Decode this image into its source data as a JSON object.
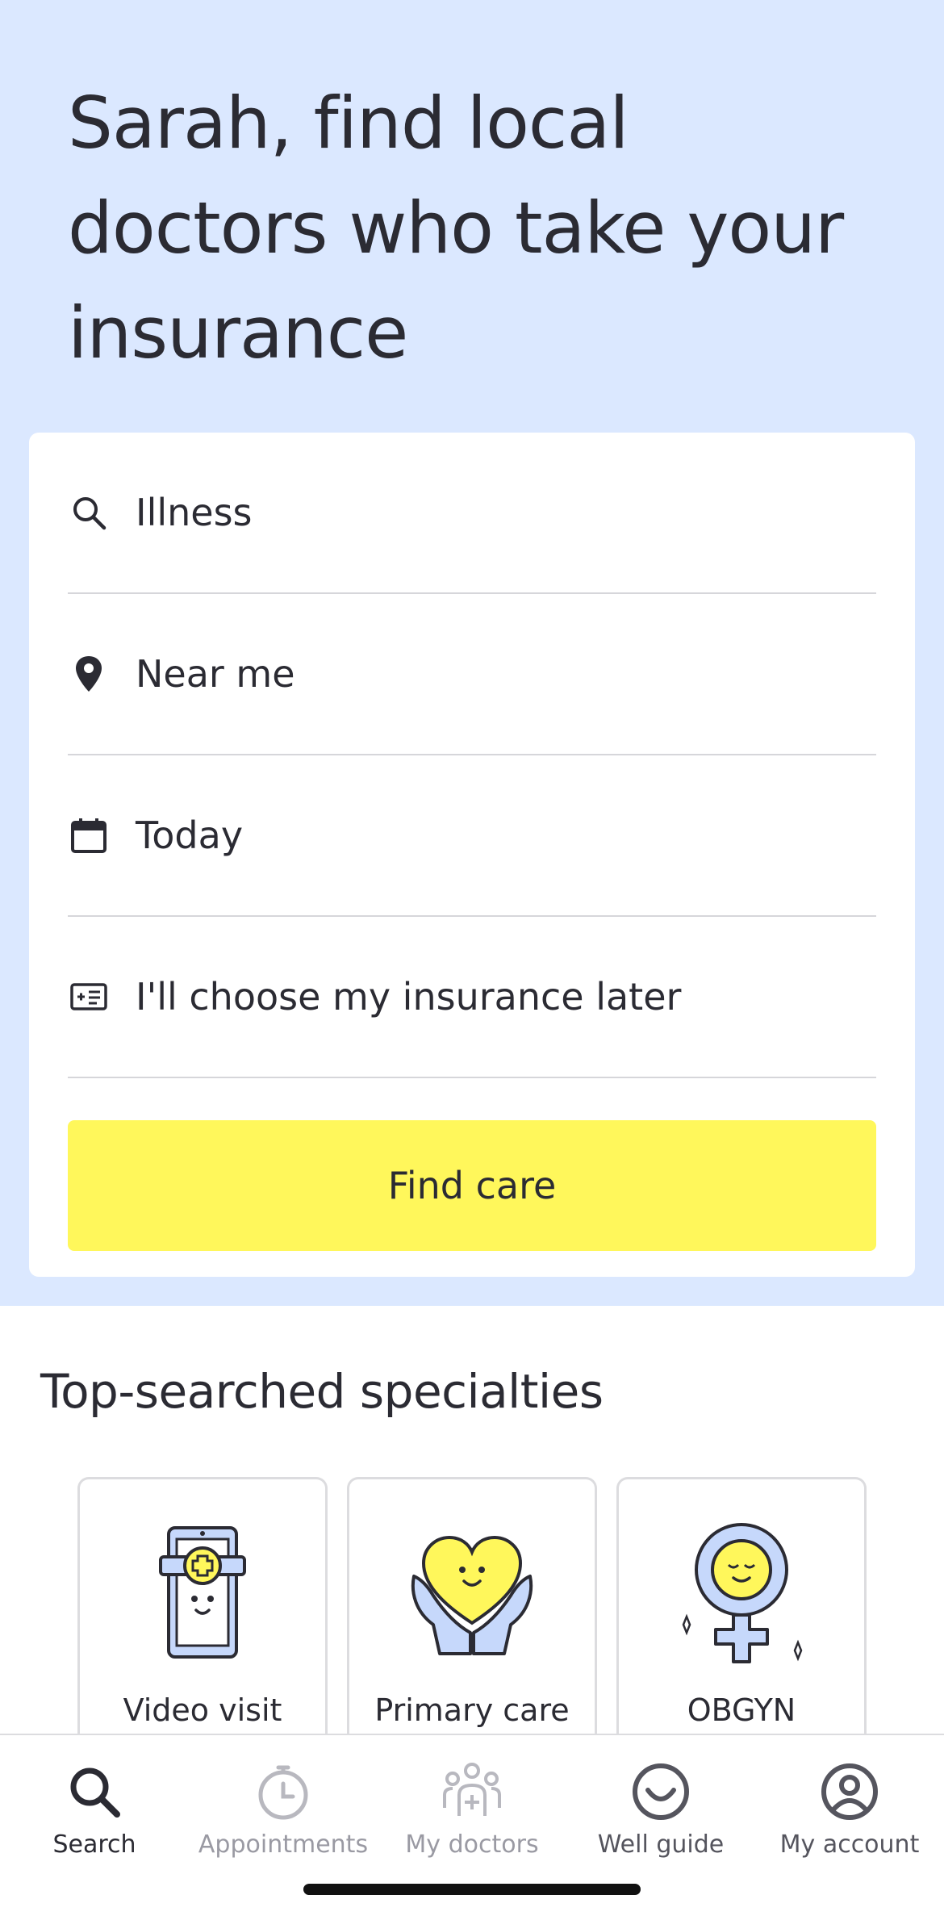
{
  "hero": {
    "title": "Sarah, find local doctors who take your insurance"
  },
  "search_form": {
    "fields": [
      {
        "icon": "search-icon",
        "value": "Illness"
      },
      {
        "icon": "location-pin-icon",
        "value": "Near me"
      },
      {
        "icon": "calendar-icon",
        "value": "Today"
      },
      {
        "icon": "insurance-card-icon",
        "value": "I'll choose my insurance later"
      }
    ],
    "submit_label": "Find care"
  },
  "specialties": {
    "title": "Top-searched specialties",
    "items": [
      {
        "label": "Video visit",
        "icon": "video-visit-tablet-icon"
      },
      {
        "label": "Primary care",
        "icon": "heart-in-hands-icon"
      },
      {
        "label": "OBGYN",
        "icon": "female-symbol-icon"
      }
    ]
  },
  "bottom_nav": {
    "items": [
      {
        "label": "Search",
        "icon": "search-icon",
        "active": true
      },
      {
        "label": "Appointments",
        "icon": "stopwatch-icon",
        "active": false
      },
      {
        "label": "My doctors",
        "icon": "doctors-group-icon",
        "active": false
      },
      {
        "label": "Well guide",
        "icon": "smile-icon",
        "active": false
      },
      {
        "label": "My account",
        "icon": "account-icon",
        "active": false
      }
    ]
  },
  "colors": {
    "hero_background": "#dbe8ff",
    "primary_button": "#fff75b",
    "text": "#2b2b33",
    "illustration_blue": "#c6d8fb",
    "illustration_yellow": "#fff75b"
  }
}
